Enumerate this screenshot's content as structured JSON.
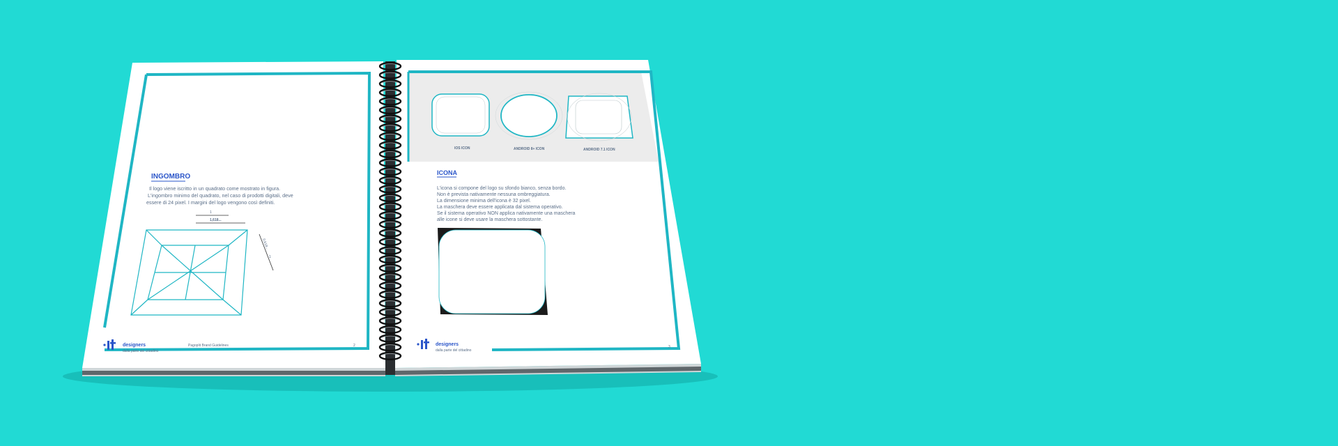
{
  "colors": {
    "background": "#21dad4",
    "accent": "#1fb6c4",
    "brand_blue": "#2a55c9",
    "page": "#ffffff"
  },
  "left_page": {
    "heading": "INGOMBRO",
    "body_lines": [
      "Il logo viene iscritto in un quadrato come mostrato in figura.",
      "L'ingombro minimo del quadrato, nel caso di prodotti digitali, deve",
      "essere di 24 pixel. I margini del logo vengono così definiti."
    ],
    "dim_top": "1",
    "dim_ratio": "1,618...",
    "dim_side_a": "0,618...",
    "dim_side_b": "1",
    "footer_brand": "designers",
    "footer_tagline": "dalla parte del cittadino",
    "footer_doc": "Pagoplit Brand Guidelines",
    "page_number": "2"
  },
  "right_page": {
    "icon_labels": [
      "IOS ICON",
      "ANDROID 8+ ICON",
      "ANDROID 7.1 ICON"
    ],
    "heading": "ICONA",
    "body_lines": [
      "L'icona si compone del logo su sfondo bianco, senza bordo.",
      "Non è prevista nativamente nessuna ombreggiatura.",
      "La dimensione minima dell'icona è 32 pixel.",
      "La maschera deve essere applicata dal sistema operativo.",
      "Se il sistema operativo NON applica nativamente una maschera",
      "alle icone si deve usare la maschera sottostante."
    ],
    "footer_brand": "designers",
    "footer_tagline": "dalla parte del cittadino",
    "page_number": "3"
  }
}
